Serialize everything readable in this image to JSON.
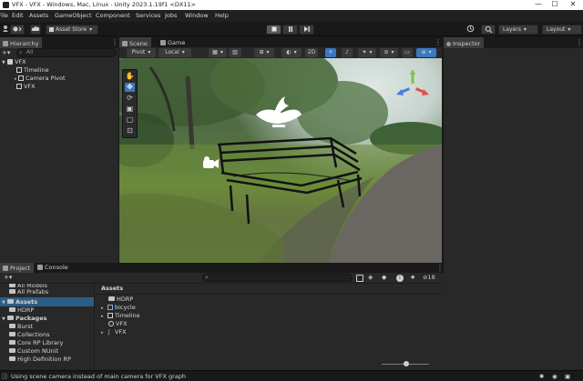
{
  "window": {
    "title": "VFX - VFX - Windows, Mac, Linux - Unity 2023.1.19f1 <DX11>",
    "controls": [
      "—",
      "☐",
      "✕"
    ]
  },
  "menu": [
    "File",
    "Edit",
    "Assets",
    "GameObject",
    "Component",
    "Services",
    "Jobs",
    "Window",
    "Help"
  ],
  "toolbar": {
    "asset_store": "Asset Store",
    "layers": "Layers",
    "layout": "Layout"
  },
  "hierarchy": {
    "tab": "Hierarchy",
    "search_placeholder": "All",
    "items": [
      {
        "label": "VFX",
        "indent": 0,
        "expanded": true
      },
      {
        "label": "Timeline",
        "indent": 1
      },
      {
        "label": "Camera Pivot",
        "indent": 1,
        "has_children": true
      },
      {
        "label": "VFX",
        "indent": 1
      }
    ]
  },
  "scene": {
    "tabs": [
      "Scene",
      "Game"
    ],
    "pivot": "Pivot",
    "local": "Local",
    "mode_2d": "2D"
  },
  "inspector": {
    "tab": "Inspector"
  },
  "project": {
    "tabs": [
      "Project",
      "Console"
    ],
    "left_tree": [
      {
        "label": "All Prefabs",
        "indent": 1,
        "bold": false
      },
      {
        "label": "Assets",
        "indent": 0,
        "bold": true
      },
      {
        "label": "HDRP",
        "indent": 1,
        "bold": false
      },
      {
        "label": "Packages",
        "indent": 0,
        "bold": true
      },
      {
        "label": "Burst",
        "indent": 1,
        "bold": false
      },
      {
        "label": "Collections",
        "indent": 1,
        "bold": false
      },
      {
        "label": "Core RP Library",
        "indent": 1,
        "bold": false
      },
      {
        "label": "Custom NUnit",
        "indent": 1,
        "bold": false
      },
      {
        "label": "High Definition RP",
        "indent": 1,
        "bold": false
      }
    ],
    "breadcrumb": "Assets",
    "assets": [
      {
        "label": "HDRP",
        "kind": "folder"
      },
      {
        "label": "bicycle",
        "kind": "mesh"
      },
      {
        "label": "Timeline",
        "kind": "timeline"
      },
      {
        "label": "VFX",
        "kind": "unity"
      },
      {
        "label": "VFX",
        "kind": "vfx"
      }
    ],
    "hidden_count": "18"
  },
  "status": {
    "message": "Using scene camera instead of main camera for VFX graph"
  },
  "colors": {
    "accent_blue": "#3a78c2",
    "panel": "#282828",
    "toolbar": "#191919"
  }
}
